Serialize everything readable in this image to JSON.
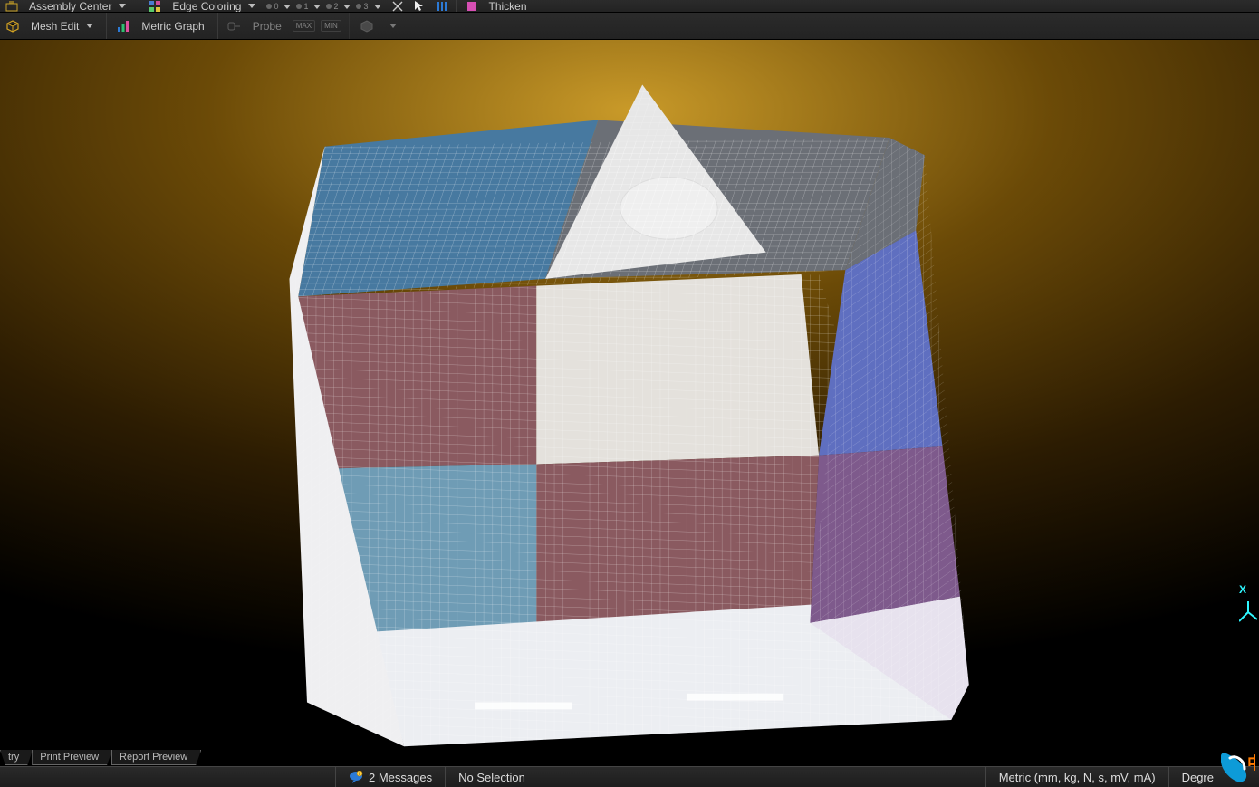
{
  "toolbar_top": {
    "assembly_center": "Assembly Center",
    "edge_coloring": "Edge Coloring",
    "sub0": "0",
    "sub1": "1",
    "sub2": "2",
    "sub3": "3",
    "thicken": "Thicken"
  },
  "toolbar_second": {
    "mesh_edit": "Mesh Edit",
    "metric_graph": "Metric Graph",
    "probe": "Probe",
    "max": "MAX",
    "min": "MIN"
  },
  "triad": {
    "x": "X"
  },
  "tabs": {
    "t0": "try",
    "t1": "Print Preview",
    "t2": "Report Preview"
  },
  "status": {
    "messages": "2 Messages",
    "selection": "No Selection",
    "units": "Metric (mm, kg, N, s, mV, mA)",
    "angle": "Degre"
  },
  "ime": "中"
}
